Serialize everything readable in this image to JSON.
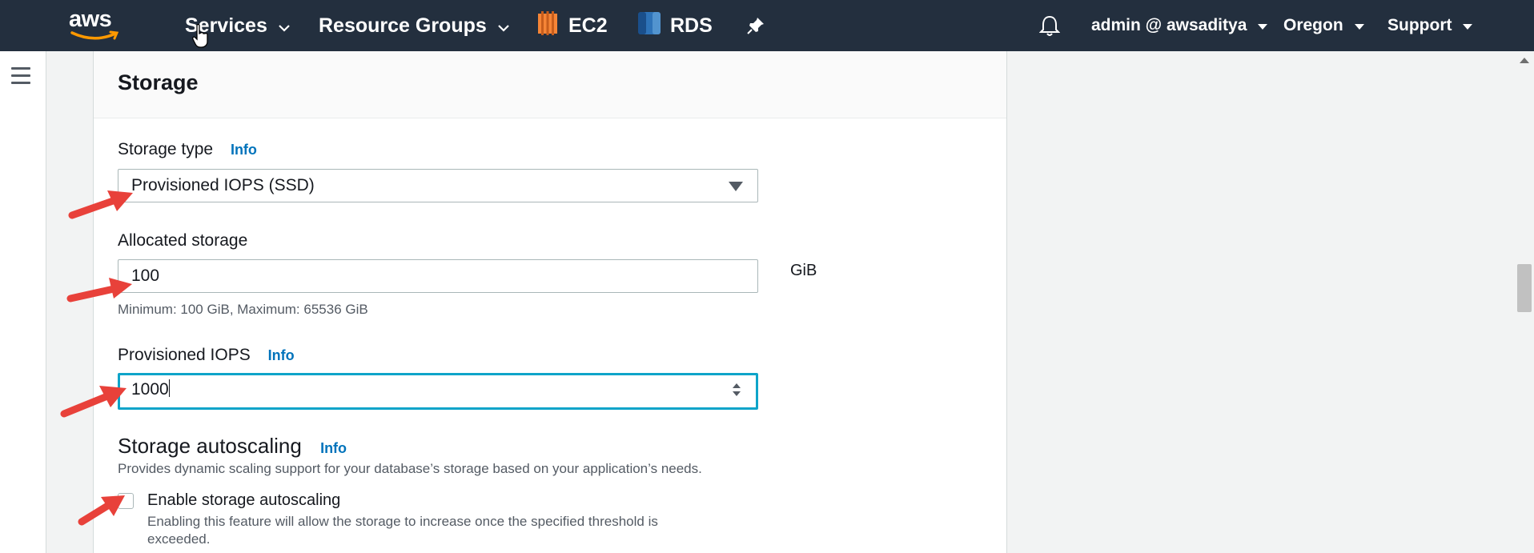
{
  "nav": {
    "logo_text": "aws",
    "services": "Services",
    "resource_groups": "Resource Groups",
    "ec2": "EC2",
    "rds": "RDS",
    "user": "admin @ awsaditya",
    "region": "Oregon",
    "support": "Support"
  },
  "storage": {
    "title": "Storage",
    "storage_type_label": "Storage type",
    "info": "Info",
    "storage_type_value": "Provisioned IOPS (SSD)",
    "allocated_label": "Allocated storage",
    "allocated_value": "100",
    "unit": "GiB",
    "allocated_hint": "Minimum: 100 GiB, Maximum: 65536 GiB",
    "iops_label": "Provisioned IOPS",
    "iops_value": "1000"
  },
  "autoscaling": {
    "title": "Storage autoscaling",
    "info": "Info",
    "description": "Provides dynamic scaling support for your database’s storage based on your application’s needs.",
    "checkbox_label": "Enable storage autoscaling",
    "checkbox_checked": false,
    "checkbox_help_line1": "Enabling this feature will allow the storage to increase once the specified threshold is",
    "checkbox_help_line2": "exceeded."
  },
  "colors": {
    "nav_bg": "#232f3e",
    "info_link": "#0073bb",
    "focus_border": "#0ea4c9",
    "annotation_arrow": "#e8413a"
  }
}
